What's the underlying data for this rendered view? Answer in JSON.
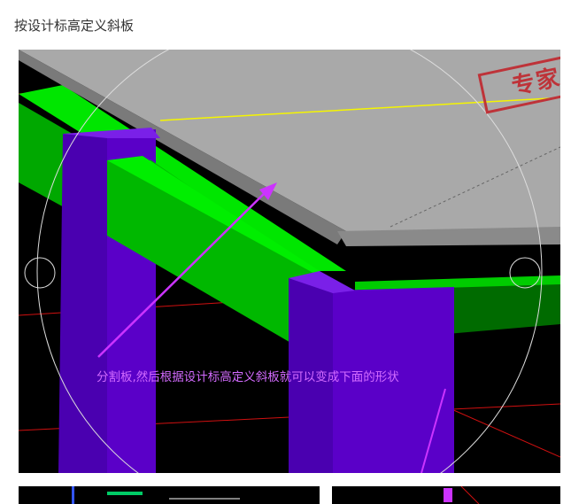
{
  "title": "按设计标高定义斜板",
  "annotation": "分割板,然后根据设计标高定义斜板就可以变成下面的形状",
  "stamp": "专家",
  "colors": {
    "background": "#000000",
    "slab_top": "#a9a9a9",
    "beam_green": "#00cc00",
    "column_purple": "#5a00c8",
    "annotation": "#d36bff",
    "arrow": "#cc33ff",
    "stamp": "#c1272d"
  }
}
